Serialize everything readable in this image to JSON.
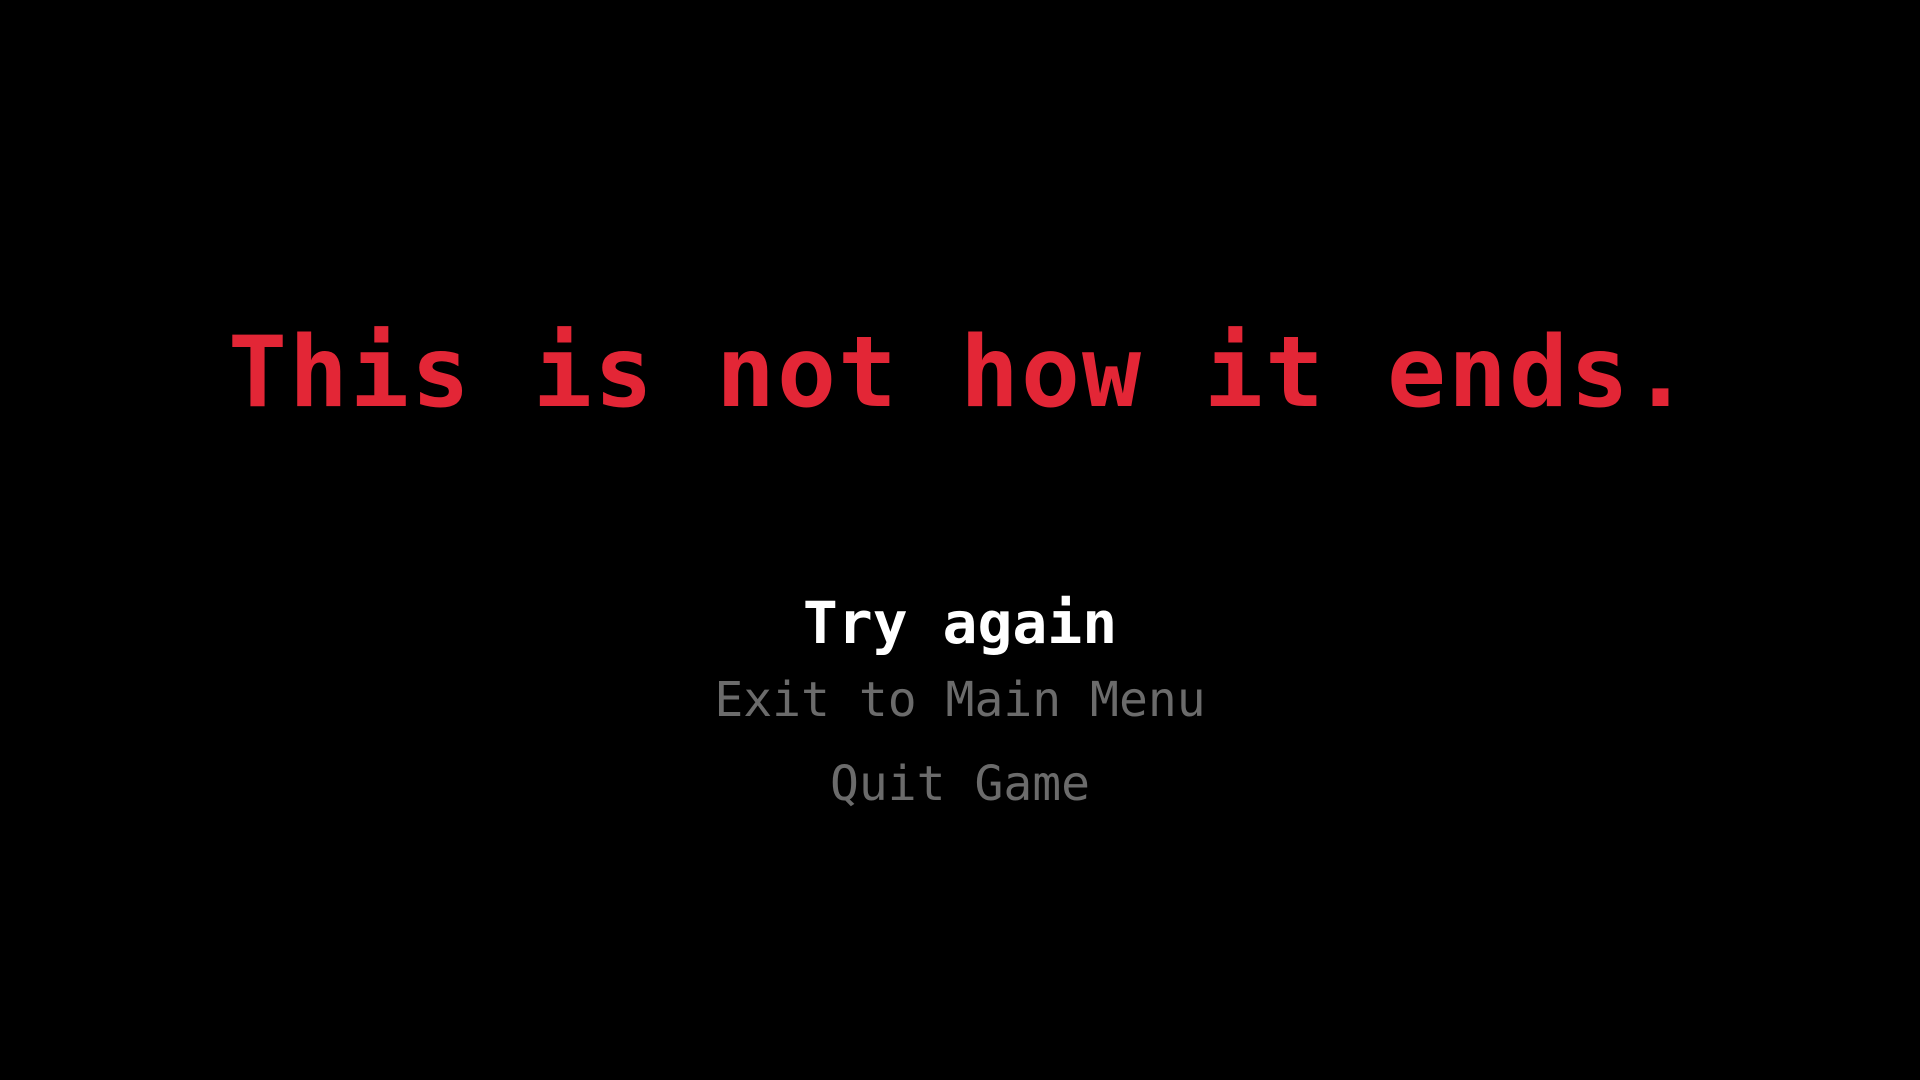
{
  "colors": {
    "background": "#000000",
    "headline": "#e32636",
    "menu_selected": "#ffffff",
    "menu_normal": "#6b6b6b"
  },
  "game_over": {
    "headline": "This is not how it ends."
  },
  "menu": {
    "selected_index": 0,
    "items": [
      {
        "label": "Try again"
      },
      {
        "label": "Exit to Main Menu"
      },
      {
        "label": "Quit Game"
      }
    ]
  }
}
